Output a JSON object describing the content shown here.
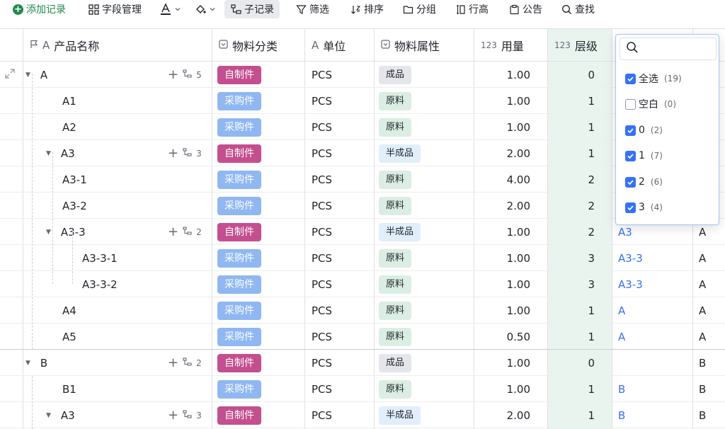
{
  "toolbar": {
    "add_record": "添加记录",
    "field_manage": "字段管理",
    "sub_records": "子记录",
    "filter": "筛选",
    "sort": "排序",
    "group": "分组",
    "row_height": "行高",
    "announce": "公告",
    "find": "查找"
  },
  "columns": {
    "name": "产品名称",
    "category": "物料分类",
    "unit": "单位",
    "attr": "物料属性",
    "usage": "用量",
    "level": "层级",
    "num_prefix": "123"
  },
  "rows": [
    {
      "name": "A",
      "category": "自制件",
      "unit": "PCS",
      "attr": "成品",
      "usage": "1.00",
      "level": "0",
      "parent": "",
      "last": "",
      "children": "5"
    },
    {
      "name": "A1",
      "category": "采购件",
      "unit": "PCS",
      "attr": "原料",
      "usage": "1.00",
      "level": "1",
      "parent": "",
      "last": "",
      "children": ""
    },
    {
      "name": "A2",
      "category": "采购件",
      "unit": "PCS",
      "attr": "原料",
      "usage": "1.00",
      "level": "1",
      "parent": "",
      "last": "",
      "children": ""
    },
    {
      "name": "A3",
      "category": "自制件",
      "unit": "PCS",
      "attr": "半成品",
      "usage": "2.00",
      "level": "1",
      "parent": "",
      "last": "",
      "children": "3"
    },
    {
      "name": "A3-1",
      "category": "采购件",
      "unit": "PCS",
      "attr": "原料",
      "usage": "4.00",
      "level": "2",
      "parent": "",
      "last": "",
      "children": ""
    },
    {
      "name": "A3-2",
      "category": "采购件",
      "unit": "PCS",
      "attr": "原料",
      "usage": "2.00",
      "level": "2",
      "parent": "",
      "last": "",
      "children": ""
    },
    {
      "name": "A3-3",
      "category": "自制件",
      "unit": "PCS",
      "attr": "半成品",
      "usage": "1.00",
      "level": "2",
      "parent": "A3",
      "last": "A",
      "children": "2"
    },
    {
      "name": "A3-3-1",
      "category": "采购件",
      "unit": "PCS",
      "attr": "原料",
      "usage": "1.00",
      "level": "3",
      "parent": "A3-3",
      "last": "A",
      "children": ""
    },
    {
      "name": "A3-3-2",
      "category": "采购件",
      "unit": "PCS",
      "attr": "原料",
      "usage": "1.00",
      "level": "3",
      "parent": "A3-3",
      "last": "A",
      "children": ""
    },
    {
      "name": "A4",
      "category": "采购件",
      "unit": "PCS",
      "attr": "原料",
      "usage": "1.00",
      "level": "1",
      "parent": "A",
      "last": "A",
      "children": ""
    },
    {
      "name": "A5",
      "category": "采购件",
      "unit": "PCS",
      "attr": "原料",
      "usage": "0.50",
      "level": "1",
      "parent": "A",
      "last": "A",
      "children": ""
    },
    {
      "name": "B",
      "category": "自制件",
      "unit": "PCS",
      "attr": "成品",
      "usage": "1.00",
      "level": "0",
      "parent": "",
      "last": "B",
      "children": "2"
    },
    {
      "name": "B1",
      "category": "采购件",
      "unit": "PCS",
      "attr": "原料",
      "usage": "1.00",
      "level": "1",
      "parent": "B",
      "last": "B",
      "children": ""
    },
    {
      "name": "A3",
      "category": "自制件",
      "unit": "PCS",
      "attr": "半成品",
      "usage": "2.00",
      "level": "1",
      "parent": "B",
      "last": "B",
      "children": "3"
    }
  ],
  "filter_dropdown": {
    "search_placeholder": "",
    "items": [
      {
        "label": "全选",
        "count": "(19)",
        "checked": true
      },
      {
        "label": "空白",
        "count": "(0)",
        "checked": false
      },
      {
        "label": "0",
        "count": "(2)",
        "checked": true
      },
      {
        "label": "1",
        "count": "(7)",
        "checked": true
      },
      {
        "label": "2",
        "count": "(6)",
        "checked": true
      },
      {
        "label": "3",
        "count": "(4)",
        "checked": true
      }
    ]
  },
  "colors": {
    "accent": "#3370ff",
    "self_made": "#c44e8e",
    "purchased": "#8fb7f2",
    "add_green": "#1f8a4c",
    "level_bg": "#eaf4ef"
  }
}
